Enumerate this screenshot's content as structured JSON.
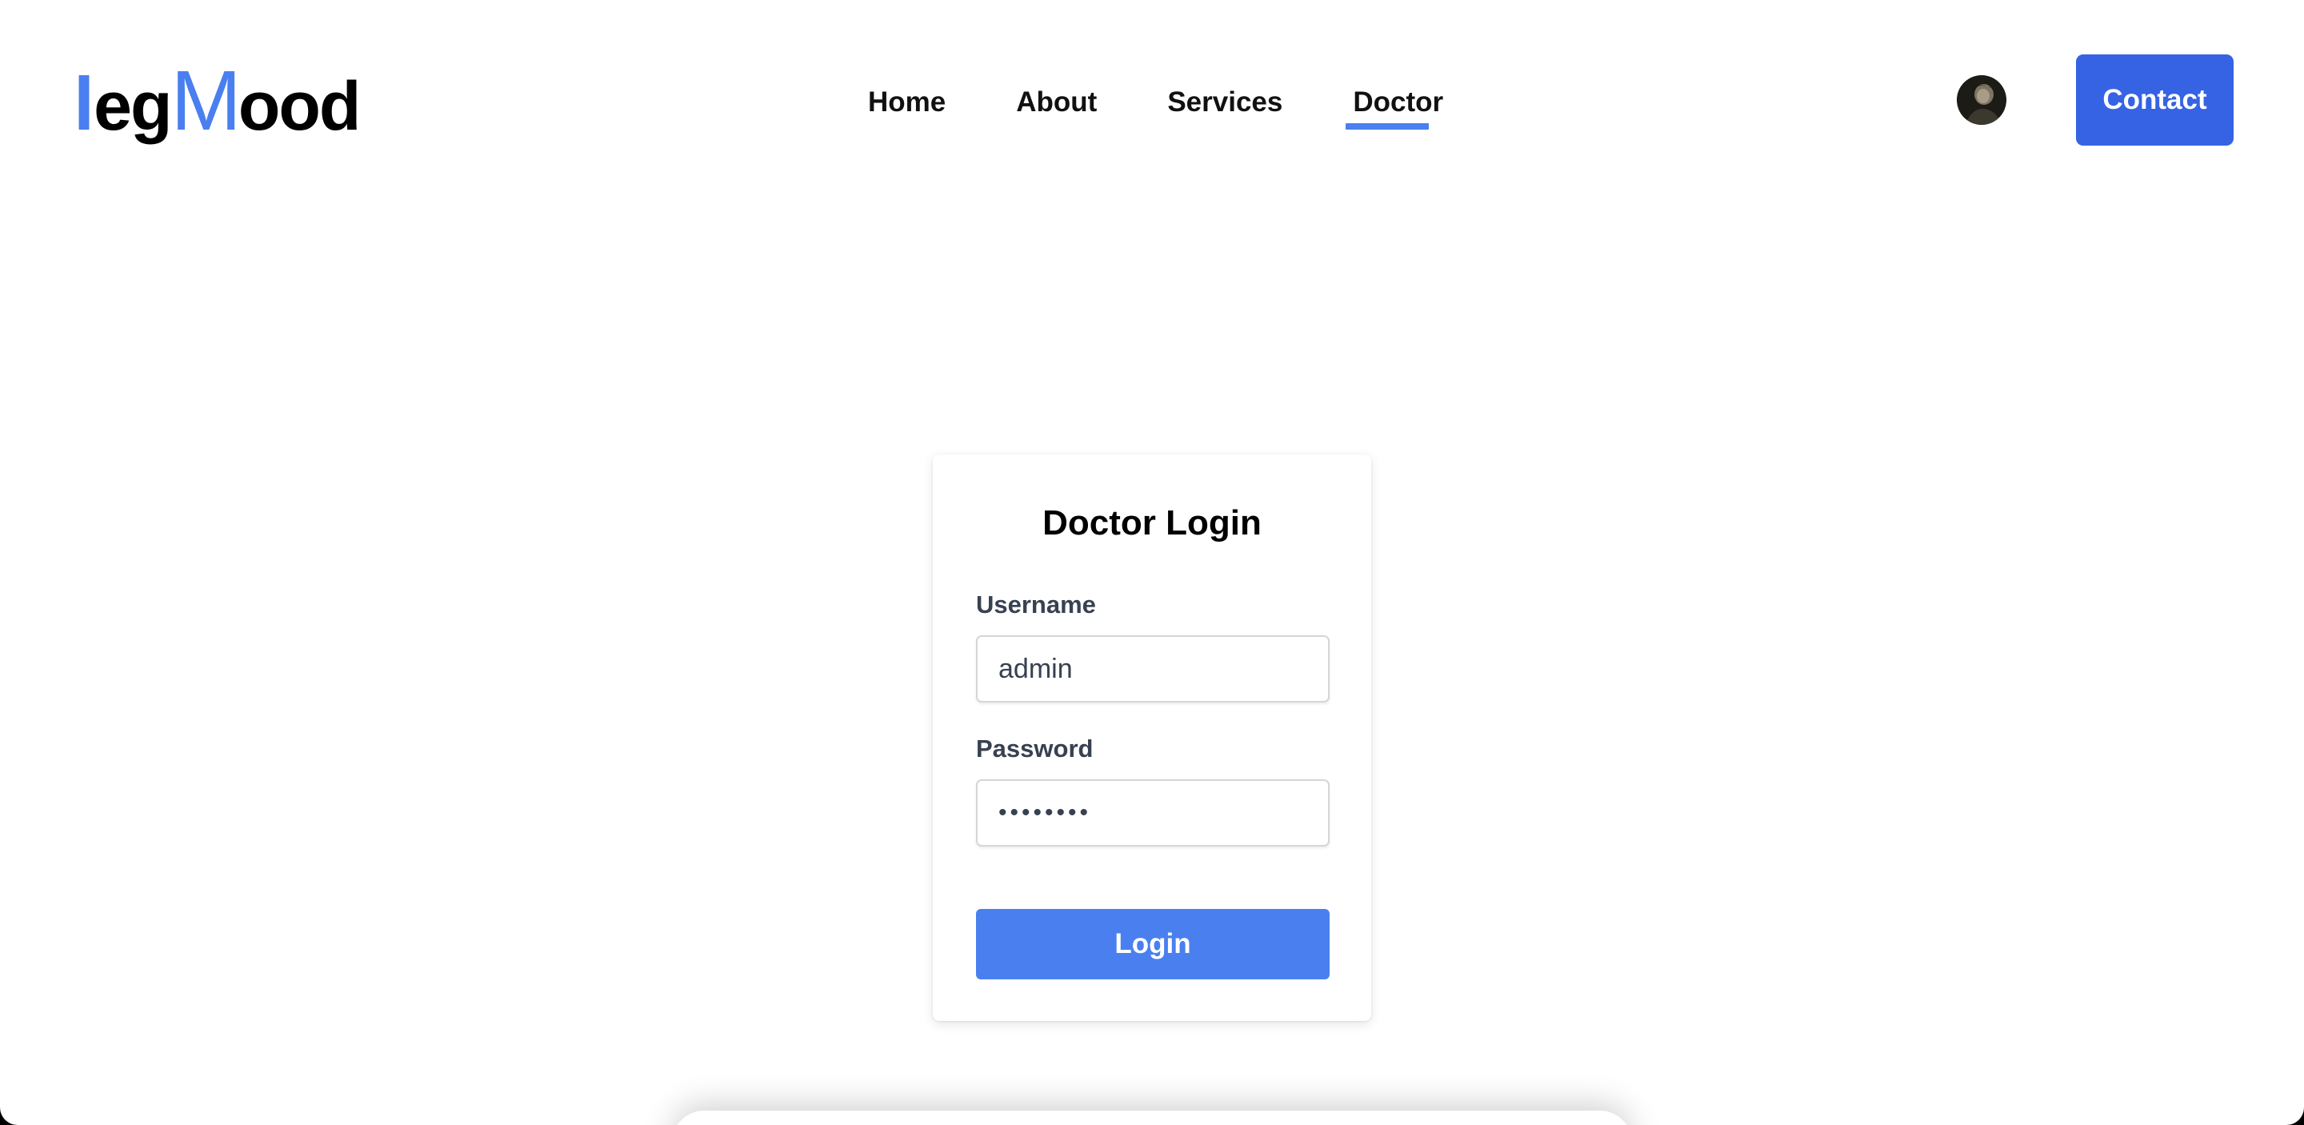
{
  "header": {
    "logo": {
      "part_first": "l",
      "part_eg": "eg",
      "part_m": "M",
      "part_ood": "ood"
    },
    "nav": [
      {
        "label": "Home",
        "active": false
      },
      {
        "label": "About",
        "active": false
      },
      {
        "label": "Services",
        "active": false
      },
      {
        "label": "Doctor",
        "active": true
      }
    ],
    "avatar_icon": "user-avatar-photo",
    "contact_label": "Contact"
  },
  "login": {
    "title": "Doctor Login",
    "username_label": "Username",
    "username_value": "admin",
    "password_label": "Password",
    "password_value": "••••••••",
    "submit_label": "Login"
  },
  "colors": {
    "accent": "#4a7ff0",
    "contact_button": "#3563e4",
    "label_text": "#374151"
  }
}
